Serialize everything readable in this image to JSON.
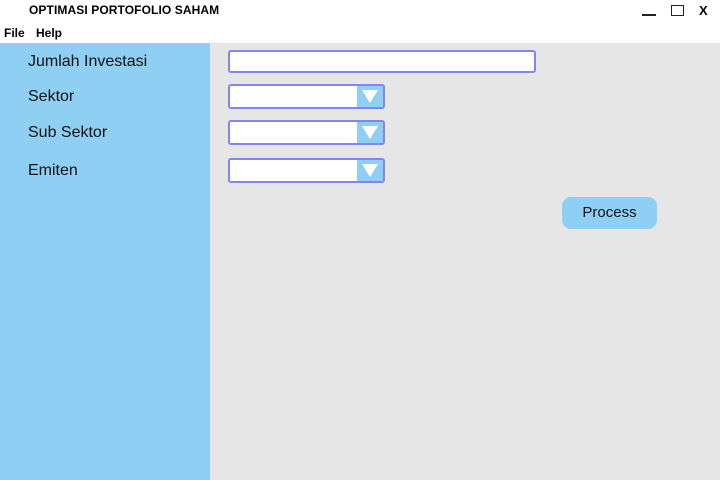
{
  "window": {
    "title": "OPTIMASI PORTOFOLIO SAHAM",
    "controls": {
      "minimize_icon": "minimize-icon",
      "maximize_icon": "maximize-icon",
      "close_icon": "close-icon",
      "close_glyph": "X"
    }
  },
  "menu": {
    "items": [
      {
        "label": "File"
      },
      {
        "label": "Help"
      }
    ]
  },
  "form": {
    "investment_amount": {
      "label": "Jumlah Investasi",
      "value": "",
      "placeholder": ""
    },
    "sector": {
      "label": "Sektor",
      "selected": ""
    },
    "sub_sector": {
      "label": "Sub Sektor",
      "selected": ""
    },
    "issuer": {
      "label": "Emiten",
      "selected": ""
    },
    "process_label": "Process",
    "dropdown_icon": "chevron-down-icon"
  },
  "colors": {
    "sidebar": "#8ecff3",
    "content_bg": "#e6e6e6",
    "field_border": "#8285ee",
    "button": "#8ecff3"
  }
}
